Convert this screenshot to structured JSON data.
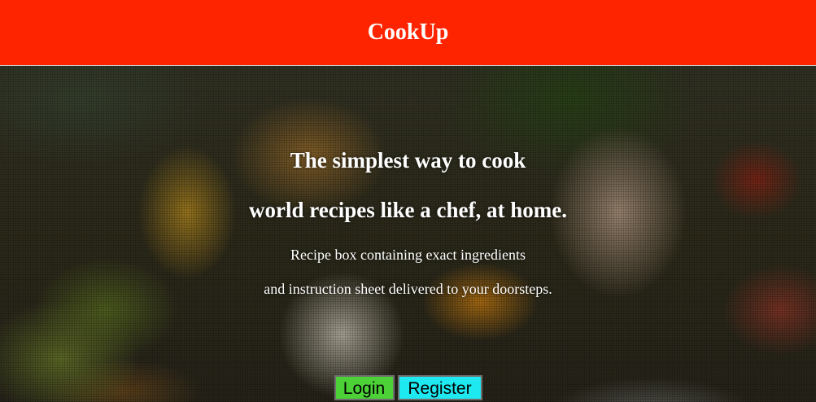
{
  "header": {
    "brand": "CookUp"
  },
  "hero": {
    "heading_line1": "The simplest way to cook",
    "heading_line2": "world recipes like a chef, at home.",
    "description_line1": "Recipe box containing exact ingredients",
    "description_line2": "and instruction sheet delivered to your doorsteps."
  },
  "actions": {
    "login_label": "Login",
    "register_label": "Register"
  },
  "colors": {
    "header_bg": "#ff2400",
    "login_bg": "#4cd137",
    "register_bg": "#1ee8f0",
    "text": "#ffffff"
  }
}
